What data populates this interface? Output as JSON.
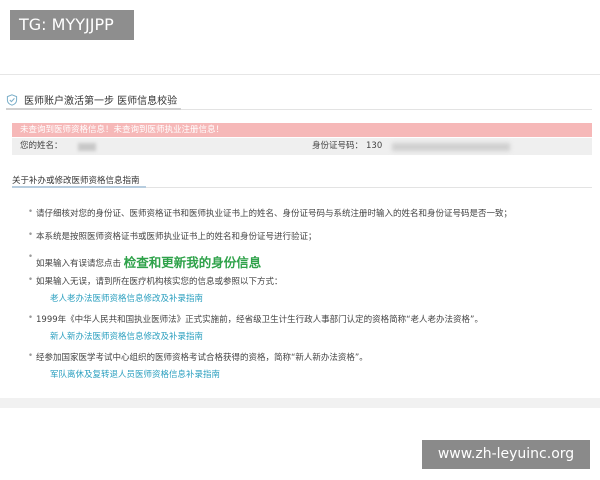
{
  "badge": "TG: MYYJJPP",
  "header": {
    "title": "医师账户激活第一步 医师信息校验",
    "icon": "shield-check-icon",
    "accent_color": "#7aaec8"
  },
  "alert": {
    "text": "未查询到医师资格信息！未查询到医师执业注册信息！",
    "bg_color": "#f6b8b8"
  },
  "info": {
    "name_label": "您的姓名：",
    "id_label": "身份证号码：",
    "id_value_prefix": "130"
  },
  "guide": {
    "title": "关于补办或修改医师资格信息指南",
    "items": [
      "请仔细核对您的身份证、医师资格证书和医师执业证书上的姓名、身份证号码与系统注册时输入的姓名和身份证号码是否一致；",
      "本系统是按照医师资格证书或医师执业证书上的姓名和身份证号进行验证；",
      "如果输入有误请您点击",
      "如果输入无误，请到所在医疗机构核实您的信息或参照以下方式：",
      "1999年《中华人民共和国执业医师法》正式实施前，经省级卫生计生行政人事部门认定的资格简称“老人老办法资格”。",
      "经参加国家医学考试中心组织的医师资格考试合格获得的资格，简称“新人新办法资格”。"
    ],
    "update_link": "检查和更新我的身份信息",
    "links": [
      "老人老办法医师资格信息修改及补录指南",
      "新人新办法医师资格信息修改及补录指南",
      "军队离休及复转退人员医师资格信息补录指南"
    ],
    "link_color": "#2a9fbf",
    "big_link_color": "#2fa24a"
  },
  "watermark": "www.zh-leyuinc.org"
}
